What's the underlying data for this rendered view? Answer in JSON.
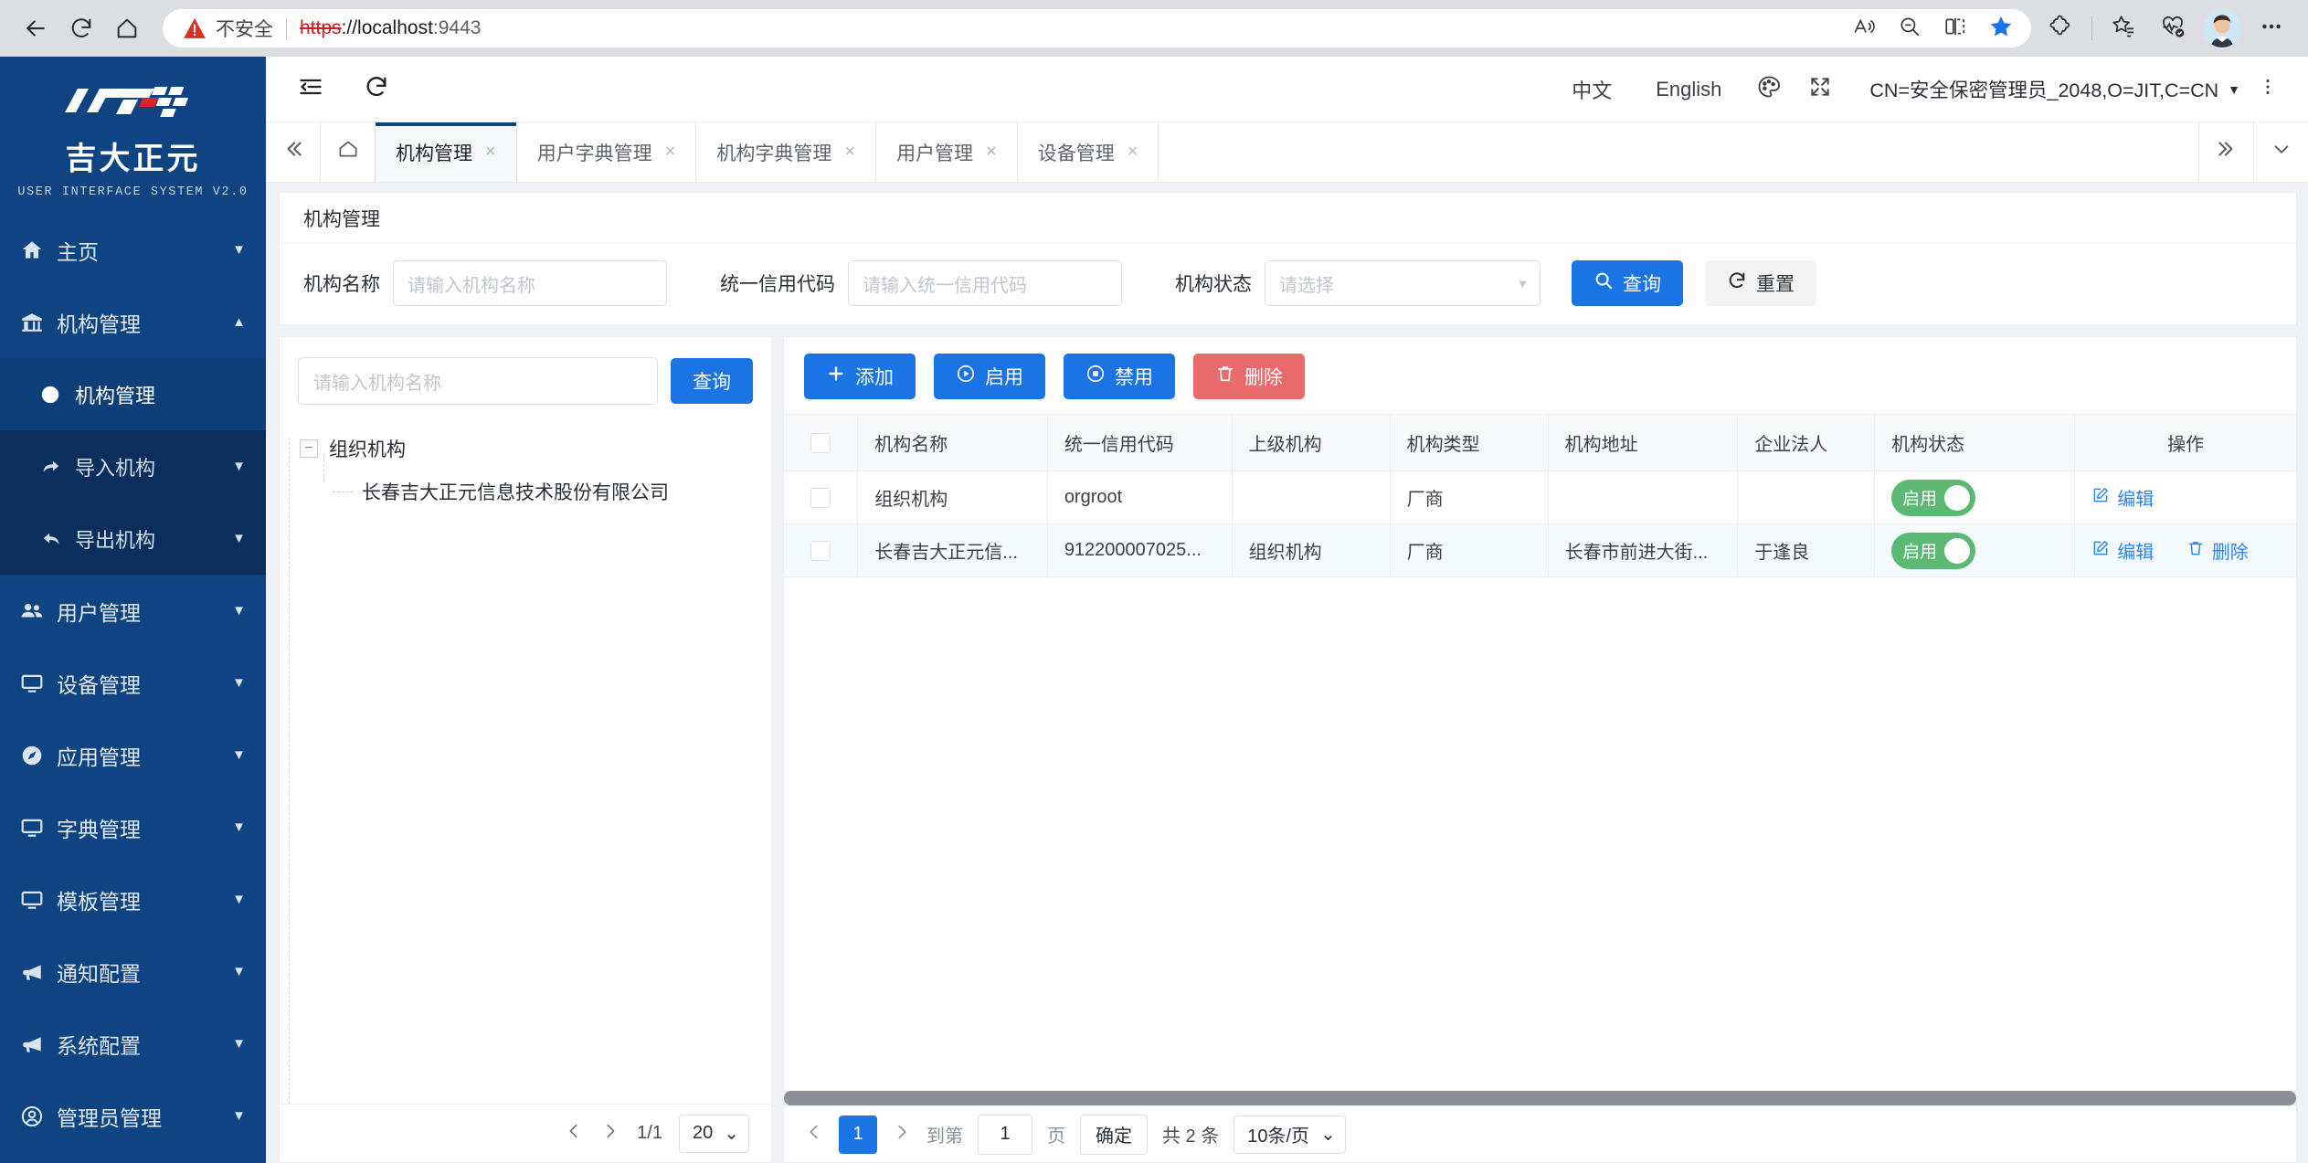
{
  "browser": {
    "back_icon": "back-arrow-icon",
    "reload_icon": "reload-icon",
    "home_icon": "home-icon",
    "security_warning": "不安全",
    "url_scheme": "https",
    "url_rest": "://localhost",
    "url_port": ":9443",
    "read_aloud_icon": "read-aloud-icon",
    "zoom_out_icon": "zoom-out-icon",
    "split_screen_icon": "split-screen-icon",
    "favorite_icon": "star-filled-icon",
    "extensions_icon": "extensions-puzzle-icon",
    "collections_icon": "collections-star-icon",
    "health_icon": "heartbeat-icon",
    "profile_icon": "profile-avatar",
    "more_icon": "more-horizontal-icon"
  },
  "sidebar": {
    "brand_cn": "吉大正元",
    "brand_en": "USER INTERFACE SYSTEM V2.0",
    "items": [
      {
        "label": "主页",
        "icon": "home-icon",
        "caret": "▼"
      },
      {
        "label": "机构管理",
        "icon": "bank-icon",
        "caret": "▲"
      },
      {
        "label": "用户管理",
        "icon": "users-icon",
        "caret": "▼"
      },
      {
        "label": "设备管理",
        "icon": "monitor-icon",
        "caret": "▼"
      },
      {
        "label": "应用管理",
        "icon": "compass-icon",
        "caret": "▼"
      },
      {
        "label": "字典管理",
        "icon": "monitor-icon",
        "caret": "▼"
      },
      {
        "label": "模板管理",
        "icon": "monitor-icon",
        "caret": "▼"
      },
      {
        "label": "通知配置",
        "icon": "megaphone-icon",
        "caret": "▼"
      },
      {
        "label": "系统配置",
        "icon": "megaphone-icon",
        "caret": "▼"
      },
      {
        "label": "管理员管理",
        "icon": "user-circle-icon",
        "caret": "▼"
      }
    ],
    "submenu": [
      {
        "label": "机构管理",
        "icon": "globe-icon",
        "caret": ""
      },
      {
        "label": "导入机构",
        "icon": "import-arrow-icon",
        "caret": "▼"
      },
      {
        "label": "导出机构",
        "icon": "export-arrow-icon",
        "caret": "▼"
      }
    ]
  },
  "topbar": {
    "collapse_icon": "menu-collapse-icon",
    "refresh_icon": "refresh-icon",
    "lang_cn": "中文",
    "lang_en": "English",
    "theme_icon": "palette-icon",
    "fullscreen_icon": "fullscreen-icon",
    "user_dn": "CN=安全保密管理员_2048,O=JIT,C=CN",
    "user_caret": "▼",
    "kebab_icon": "more-vertical-icon"
  },
  "tabbar": {
    "collapse_left_icon": "chevron-double-left-icon",
    "home_icon": "home-outline-icon",
    "scroll_right_icon": "chevron-double-right-icon",
    "dropdown_icon": "chevron-down-icon",
    "tabs": [
      {
        "label": "机构管理",
        "closable": true,
        "active": true
      },
      {
        "label": "用户字典管理",
        "closable": true,
        "active": false
      },
      {
        "label": "机构字典管理",
        "closable": true,
        "active": false
      },
      {
        "label": "用户管理",
        "closable": true,
        "active": false
      },
      {
        "label": "设备管理",
        "closable": true,
        "active": false
      }
    ],
    "close_glyph": "×"
  },
  "page": {
    "breadcrumb": "机构管理"
  },
  "filters": {
    "name_label": "机构名称",
    "name_placeholder": "请输入机构名称",
    "code_label": "统一信用代码",
    "code_placeholder": "请输入统一信用代码",
    "status_label": "机构状态",
    "status_placeholder": "请选择",
    "search_label": "查询",
    "search_icon": "search-icon",
    "reset_label": "重置",
    "reset_icon": "refresh-icon"
  },
  "tree": {
    "search_placeholder": "请输入机构名称",
    "search_button": "查询",
    "root": "组织机构",
    "root_expander": "−",
    "child": "长春吉大正元信息技术股份有限公司",
    "pager": {
      "prev_icon": "chevron-left-icon",
      "next_icon": "chevron-right-icon",
      "page_text": "1/1",
      "size_value": "20",
      "size_caret": "⌄"
    }
  },
  "table": {
    "actions": [
      {
        "label": "添加",
        "icon": "plus-icon",
        "style": "primary"
      },
      {
        "label": "启用",
        "icon": "play-circle-icon",
        "style": "primary"
      },
      {
        "label": "禁用",
        "icon": "stop-circle-icon",
        "style": "primary"
      },
      {
        "label": "删除",
        "icon": "trash-icon",
        "style": "danger"
      }
    ],
    "columns": [
      "机构名称",
      "统一信用代码",
      "上级机构",
      "机构类型",
      "机构地址",
      "企业法人",
      "机构状态",
      "操作"
    ],
    "rows": [
      {
        "name": "组织机构",
        "code": "orgroot",
        "parent": "",
        "type": "厂商",
        "address": "",
        "legal": "",
        "status": "启用",
        "actions": [
          "编辑"
        ],
        "highlight": false
      },
      {
        "name": "长春吉大正元信...",
        "code": "912200007025...",
        "parent": "组织机构",
        "type": "厂商",
        "address": "长春市前进大街...",
        "legal": "于逢良",
        "status": "启用",
        "actions": [
          "编辑",
          "删除"
        ],
        "highlight": true
      }
    ],
    "edit_icon": "edit-pencil-icon",
    "delete_icon": "trash-icon",
    "pager": {
      "prev_icon": "chevron-left-icon",
      "next_icon": "chevron-right-icon",
      "current_page": "1",
      "goto_label": "到第",
      "goto_value": "1",
      "page_unit": "页",
      "confirm_label": "确定",
      "total_text": "共 2 条",
      "size_value": "10条/页",
      "size_caret": "⌄"
    }
  },
  "colors": {
    "sidebar_bg": "#0e4481",
    "submenu_bg": "#0a2f5c",
    "primary": "#1b74e4",
    "danger": "#e96a6a",
    "switch_on": "#5bb974",
    "link": "#2b83f0"
  }
}
